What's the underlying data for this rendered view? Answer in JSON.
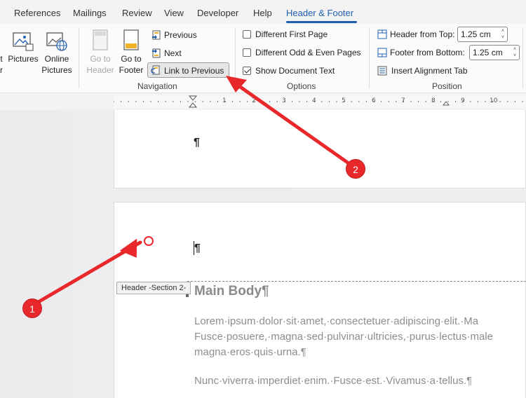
{
  "tabs": [
    {
      "label": "References"
    },
    {
      "label": "Mailings"
    },
    {
      "label": "Review"
    },
    {
      "label": "View"
    },
    {
      "label": "Developer"
    },
    {
      "label": "Help"
    },
    {
      "label": "Header & Footer",
      "active": true
    }
  ],
  "ribbon": {
    "insert": {
      "pictures_label": "Pictures",
      "online_pictures_line1": "Online",
      "online_pictures_line2": "Pictures"
    },
    "navigation": {
      "go_to_header_line1": "Go to",
      "go_to_header_line2": "Header",
      "go_to_footer_line1": "Go to",
      "go_to_footer_line2": "Footer",
      "previous_label": "Previous",
      "next_label": "Next",
      "link_to_previous_label": "Link to Previous",
      "group_label": "Navigation"
    },
    "options": {
      "different_first_page": {
        "label": "Different First Page",
        "checked": false
      },
      "different_odd_even": {
        "label": "Different Odd & Even Pages",
        "checked": false
      },
      "show_document_text": {
        "label": "Show Document Text",
        "checked": true
      },
      "group_label": "Options"
    },
    "position": {
      "header_from_top_label": "Header from Top:",
      "header_from_top_value": "1.25 cm",
      "footer_from_bottom_label": "Footer from Bottom:",
      "footer_from_bottom_value": "1.25 cm",
      "insert_alignment_tab_label": "Insert Alignment Tab",
      "group_label": "Position"
    }
  },
  "ruler": {
    "numbers": [
      "1",
      "2",
      "3",
      "4",
      "5",
      "6",
      "7",
      "8",
      "9",
      "10"
    ]
  },
  "document": {
    "page1_mark": "¶",
    "page2_mark": "¶",
    "header_tag": "Header -Section 2-",
    "heading": "Main Body¶",
    "lines": [
      "Lorem·ipsum·dolor·sit·amet,·consectetuer·adipiscing·elit.·Ma",
      "Fusce·posuere,·magna·sed·pulvinar·ultricies,·purus·lectus·male",
      "magna·eros·quis·urna.¶",
      "Nunc·viverra·imperdiet·enim.·Fusce·est.·Vivamus·a·tellus.¶"
    ]
  },
  "annotations": {
    "badge1": "1",
    "badge2": "2",
    "color": "#e8282b"
  },
  "colors": {
    "accent": "#1c5fb0",
    "annotation_red": "#e8282b"
  }
}
